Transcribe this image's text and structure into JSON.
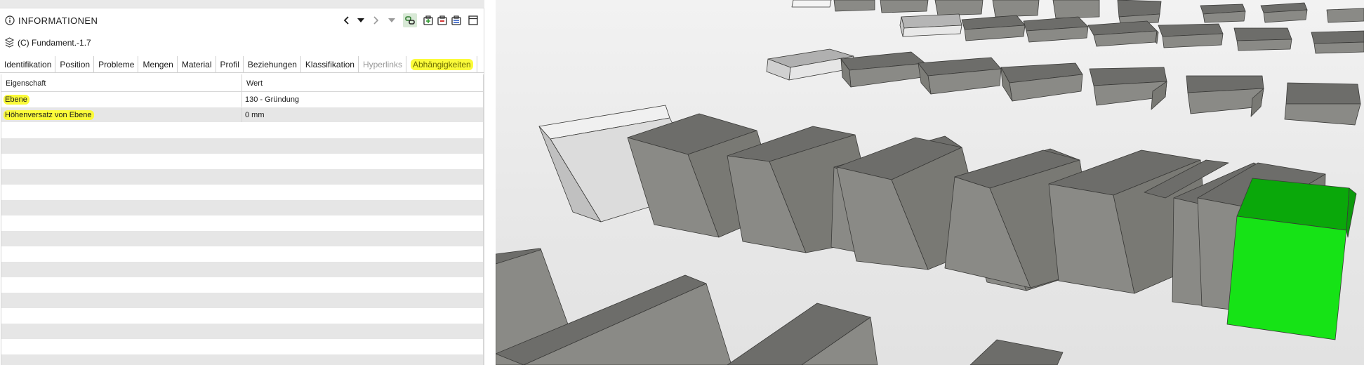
{
  "panel": {
    "title": "INFORMATIONEN",
    "element_name": "(C) Fundament.-1.7"
  },
  "tabs": [
    {
      "label": "Identifikation",
      "state": "normal"
    },
    {
      "label": "Position",
      "state": "normal"
    },
    {
      "label": "Probleme",
      "state": "normal"
    },
    {
      "label": "Mengen",
      "state": "normal"
    },
    {
      "label": "Material",
      "state": "normal"
    },
    {
      "label": "Profil",
      "state": "normal"
    },
    {
      "label": "Beziehungen",
      "state": "normal"
    },
    {
      "label": "Klassifikation",
      "state": "normal"
    },
    {
      "label": "Hyperlinks",
      "state": "disabled"
    },
    {
      "label": "Abhängigkeiten",
      "state": "active"
    }
  ],
  "table": {
    "columns": [
      "Eigenschaft",
      "Wert"
    ],
    "rows": [
      {
        "property": "Ebene",
        "value": "130 - Gründung"
      },
      {
        "property": "Höhenversatz von Ebene",
        "value": "0 mm"
      }
    ]
  },
  "icons": {
    "info": "info-icon",
    "element": "stack-icon",
    "back": "chevron-left-icon",
    "menu": "caret-down-icon",
    "forward": "chevron-right-icon",
    "filter": "filter-icon",
    "link": "chain-link-icon",
    "add": "add-group-icon",
    "remove": "remove-group-icon",
    "clear": "clear-group-icon",
    "window": "window-icon"
  },
  "colors": {
    "highlight": "#fbfb3a",
    "selected_object": "#10e010",
    "box_top": "#6d6d6a",
    "box_front": "#8a8a85",
    "box_side": "#797974"
  }
}
